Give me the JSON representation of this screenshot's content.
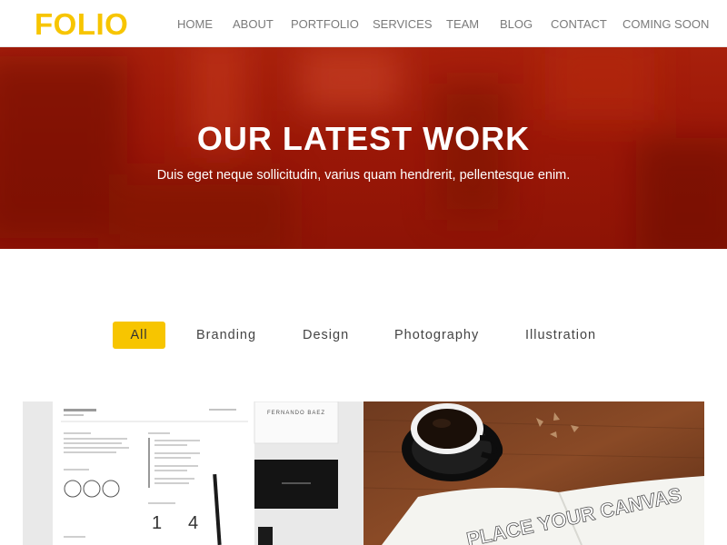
{
  "brand": {
    "name": "FOLIO"
  },
  "nav": {
    "items": [
      "HOME",
      "ABOUT",
      "PORTFOLIO",
      "SERVICES",
      "TEAM",
      "BLOG",
      "CONTACT",
      "COMING SOON"
    ]
  },
  "hero": {
    "title": "OUR LATEST WORK",
    "subtitle": "Duis eget neque sollicitudin, varius quam hendrerit, pellentesque enim."
  },
  "filters": {
    "items": [
      "All",
      "Branding",
      "Design",
      "Photography",
      "Illustration"
    ],
    "active": "All"
  },
  "portfolio": {
    "items": [
      {
        "card_name": "FERNANDO BAEZ",
        "numbers": [
          "1",
          "4"
        ]
      },
      {
        "sketch_text": "PLACE YOUR CANVAS"
      }
    ]
  },
  "colors": {
    "accent": "#f7c500",
    "hero": "#9e1a08",
    "nav_text": "#7a7a7a"
  }
}
